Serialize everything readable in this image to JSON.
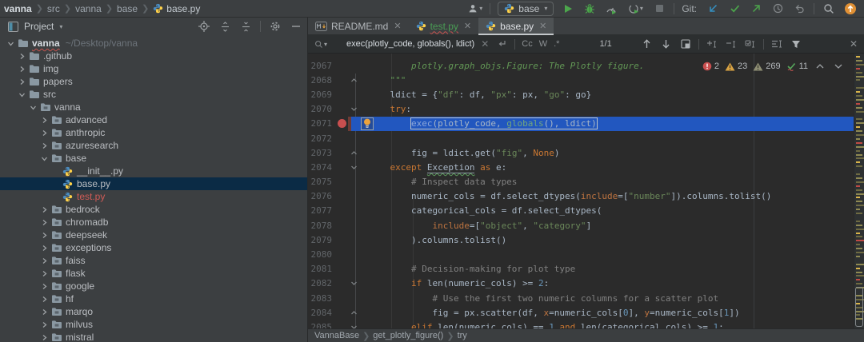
{
  "titlebar": {
    "breadcrumbs": [
      "vanna",
      "src",
      "vanna",
      "base",
      "base.py"
    ],
    "run_widget": {
      "config": "base"
    },
    "git_label": "Git:"
  },
  "project_panel": {
    "title": "Project",
    "tree": [
      {
        "label": "vanna",
        "hint": "~/Desktop/vanna",
        "depth": 0,
        "icon": "folder",
        "state": "expanded",
        "root": true
      },
      {
        "label": ".github",
        "depth": 1,
        "icon": "folder",
        "state": "collapsed"
      },
      {
        "label": "img",
        "depth": 1,
        "icon": "folder",
        "state": "collapsed"
      },
      {
        "label": "papers",
        "depth": 1,
        "icon": "folder",
        "state": "collapsed"
      },
      {
        "label": "src",
        "depth": 1,
        "icon": "folder",
        "state": "expanded"
      },
      {
        "label": "vanna",
        "depth": 2,
        "icon": "package",
        "state": "expanded"
      },
      {
        "label": "advanced",
        "depth": 3,
        "icon": "package",
        "state": "collapsed"
      },
      {
        "label": "anthropic",
        "depth": 3,
        "icon": "package",
        "state": "collapsed"
      },
      {
        "label": "azuresearch",
        "depth": 3,
        "icon": "package",
        "state": "collapsed"
      },
      {
        "label": "base",
        "depth": 3,
        "icon": "package",
        "state": "expanded"
      },
      {
        "label": "__init__.py",
        "depth": 4,
        "icon": "python",
        "state": "none"
      },
      {
        "label": "base.py",
        "depth": 4,
        "icon": "python",
        "state": "none",
        "selected": true
      },
      {
        "label": "test.py",
        "depth": 4,
        "icon": "python",
        "state": "none",
        "color": "#CF5B56"
      },
      {
        "label": "bedrock",
        "depth": 3,
        "icon": "package",
        "state": "collapsed"
      },
      {
        "label": "chromadb",
        "depth": 3,
        "icon": "package",
        "state": "collapsed"
      },
      {
        "label": "deepseek",
        "depth": 3,
        "icon": "package",
        "state": "collapsed"
      },
      {
        "label": "exceptions",
        "depth": 3,
        "icon": "package",
        "state": "collapsed"
      },
      {
        "label": "faiss",
        "depth": 3,
        "icon": "package",
        "state": "collapsed"
      },
      {
        "label": "flask",
        "depth": 3,
        "icon": "package",
        "state": "collapsed"
      },
      {
        "label": "google",
        "depth": 3,
        "icon": "package",
        "state": "collapsed"
      },
      {
        "label": "hf",
        "depth": 3,
        "icon": "package",
        "state": "collapsed"
      },
      {
        "label": "marqo",
        "depth": 3,
        "icon": "package",
        "state": "collapsed"
      },
      {
        "label": "milvus",
        "depth": 3,
        "icon": "package",
        "state": "collapsed"
      },
      {
        "label": "mistral",
        "depth": 3,
        "icon": "package",
        "state": "collapsed"
      }
    ]
  },
  "editor": {
    "tabs": [
      {
        "label": "README.md",
        "icon": "markdown",
        "active": false,
        "green": false
      },
      {
        "label": "test.py",
        "icon": "python",
        "active": false,
        "green": true
      },
      {
        "label": "base.py",
        "icon": "python",
        "active": true,
        "green": false
      }
    ],
    "find_bar": {
      "query": "exec(plotly_code, globals(), ldict)",
      "match_case_label": "Cc",
      "words_label": "W",
      "regex_label": ".*",
      "results_count": "1/1"
    },
    "inspections": {
      "errors": "2",
      "warnings": "23",
      "weak_warnings": "269",
      "typos": "11"
    },
    "code_lines": [
      {
        "no": "2067",
        "fold": "",
        "tokens": [
          [
            "di",
            "        plotly.graph_objs.Figure: The Plotly figure."
          ]
        ]
      },
      {
        "no": "2068",
        "fold": "up",
        "tokens": [
          [
            "doc",
            "    \"\"\""
          ]
        ]
      },
      {
        "no": "2069",
        "fold": "",
        "tokens": [
          [
            "d",
            "    ldict = {"
          ],
          [
            "s",
            "\"df\""
          ],
          [
            "d",
            ": df, "
          ],
          [
            "s",
            "\"px\""
          ],
          [
            "d",
            ": px, "
          ],
          [
            "s",
            "\"go\""
          ],
          [
            "d",
            ": go}"
          ]
        ]
      },
      {
        "no": "2070",
        "fold": "down",
        "tokens": [
          [
            "d",
            "    "
          ],
          [
            "k",
            "try"
          ],
          [
            "d",
            ":"
          ]
        ]
      },
      {
        "no": "2071",
        "fold": "",
        "bp": true,
        "hl": true,
        "bulb": true,
        "pre": [
          [
            "d",
            "        "
          ]
        ],
        "box": [
          [
            "bi",
            "exec"
          ],
          [
            "d",
            "(plotly_code, "
          ],
          [
            "gl",
            "globals"
          ],
          [
            "d",
            "(), ldict)"
          ]
        ],
        "tokens": []
      },
      {
        "no": "2072",
        "fold": "",
        "tokens": []
      },
      {
        "no": "2073",
        "fold": "up",
        "tokens": [
          [
            "d",
            "        fig = ldict.get("
          ],
          [
            "s",
            "\"fig\""
          ],
          [
            "d",
            ", "
          ],
          [
            "k",
            "None"
          ],
          [
            "d",
            ")"
          ]
        ]
      },
      {
        "no": "2074",
        "fold": "down",
        "tokens": [
          [
            "d",
            "    "
          ],
          [
            "k",
            "except"
          ],
          [
            "d",
            " "
          ],
          [
            "exc",
            "Exception"
          ],
          [
            "d",
            " "
          ],
          [
            "k",
            "as"
          ],
          [
            "d",
            " e:"
          ]
        ]
      },
      {
        "no": "2075",
        "fold": "",
        "tokens": [
          [
            "c",
            "        # Inspect data types"
          ]
        ]
      },
      {
        "no": "2076",
        "fold": "",
        "tokens": [
          [
            "d",
            "        numeric_cols = df.select_dtypes("
          ],
          [
            "p",
            "include"
          ],
          [
            "d",
            "=["
          ],
          [
            "s",
            "\"number\""
          ],
          [
            "d",
            "]).columns.tolist()"
          ]
        ]
      },
      {
        "no": "2077",
        "fold": "",
        "tokens": [
          [
            "d",
            "        categorical_cols = df.select_dtypes("
          ]
        ]
      },
      {
        "no": "2078",
        "fold": "",
        "tokens": [
          [
            "d",
            "            "
          ],
          [
            "p",
            "include"
          ],
          [
            "d",
            "=["
          ],
          [
            "s",
            "\"object\""
          ],
          [
            "d",
            ", "
          ],
          [
            "s",
            "\"category\""
          ],
          [
            "d",
            "]"
          ]
        ]
      },
      {
        "no": "2079",
        "fold": "",
        "tokens": [
          [
            "d",
            "        ).columns.tolist()"
          ]
        ]
      },
      {
        "no": "2080",
        "fold": "",
        "tokens": []
      },
      {
        "no": "2081",
        "fold": "",
        "tokens": [
          [
            "c",
            "        # Decision-making for plot type"
          ]
        ]
      },
      {
        "no": "2082",
        "fold": "down",
        "tokens": [
          [
            "d",
            "        "
          ],
          [
            "k",
            "if"
          ],
          [
            "d",
            " len(numeric_cols) >= "
          ],
          [
            "n",
            "2"
          ],
          [
            "d",
            ":"
          ]
        ]
      },
      {
        "no": "2083",
        "fold": "",
        "tokens": [
          [
            "c",
            "            # Use the first two numeric columns for a scatter plot"
          ]
        ]
      },
      {
        "no": "2084",
        "fold": "up",
        "tokens": [
          [
            "d",
            "            fig = px.scatter(df, "
          ],
          [
            "p",
            "x"
          ],
          [
            "d",
            "=numeric_cols["
          ],
          [
            "n",
            "0"
          ],
          [
            "d",
            "], "
          ],
          [
            "p",
            "y"
          ],
          [
            "d",
            "=numeric_cols["
          ],
          [
            "n",
            "1"
          ],
          [
            "d",
            "])"
          ]
        ]
      },
      {
        "no": "2085",
        "fold": "down",
        "tokens": [
          [
            "d",
            "        "
          ],
          [
            "k",
            "elif"
          ],
          [
            "d",
            " len(numeric_cols) == "
          ],
          [
            "n",
            "1"
          ],
          [
            "d",
            " "
          ],
          [
            "k",
            "and"
          ],
          [
            "d",
            " len(categorical_cols) >= "
          ],
          [
            "n",
            "1"
          ],
          [
            "d",
            ":"
          ]
        ]
      }
    ]
  },
  "breadcrumbs_bar": {
    "items": [
      "VannaBase",
      "get_plotly_figure()",
      "try"
    ]
  }
}
